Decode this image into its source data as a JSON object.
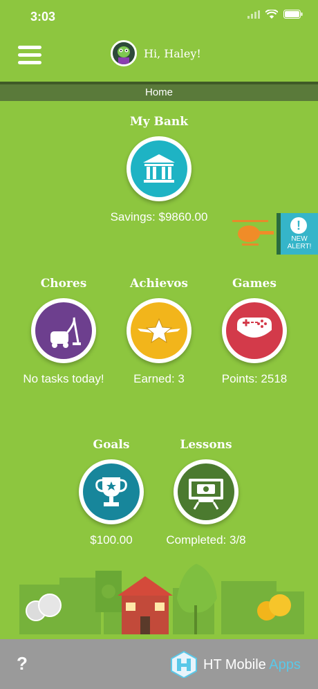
{
  "status": {
    "time": "3:03"
  },
  "header": {
    "greeting": "Hi, Haley!"
  },
  "nav": {
    "title": "Home"
  },
  "bank": {
    "title": "My Bank",
    "caption": "Savings: $9860.00"
  },
  "chores": {
    "title": "Chores",
    "caption": "No tasks today!"
  },
  "achievos": {
    "title": "Achievos",
    "caption": "Earned: 3"
  },
  "games": {
    "title": "Games",
    "caption": "Points: 2518"
  },
  "goals": {
    "title": "Goals",
    "caption": "$100.00"
  },
  "lessons": {
    "title": "Lessons",
    "caption": "Completed: 3/8"
  },
  "alert": {
    "badge": "!",
    "line1": "NEW",
    "line2": "ALERT!"
  },
  "footer": {
    "help": "?",
    "brand_main": "HT Mobile ",
    "brand_accent": "Apps"
  },
  "colors": {
    "bank": "#1eb3c4",
    "chores": "#6d3f8e",
    "achievos": "#f2b51b",
    "games": "#d33a4a",
    "goals": "#17869b",
    "lessons": "#4b7a2f"
  }
}
